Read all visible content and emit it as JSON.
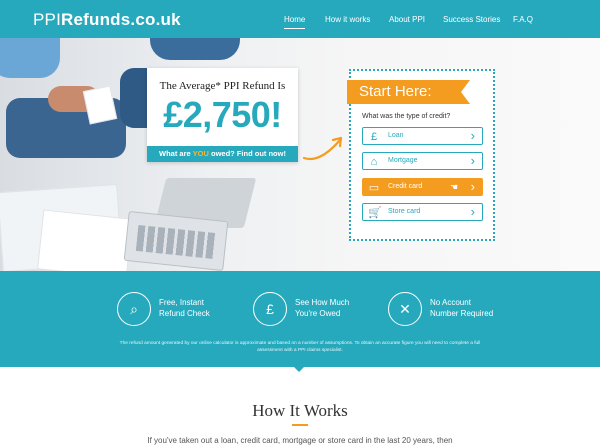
{
  "header": {
    "logo_prefix": "PPI",
    "logo_suffix": "Refunds.co.uk",
    "nav": [
      {
        "label": "Home",
        "active": true
      },
      {
        "label": "How it works"
      },
      {
        "label": "About PPI"
      },
      {
        "label": "Success Stories"
      },
      {
        "label": "F.A.Q"
      }
    ]
  },
  "hero": {
    "refund_title": "The Average* PPI Refund Is",
    "refund_amount": "£2,750!",
    "cta_prefix": "What are ",
    "cta_emph": "YOU",
    "cta_suffix": " owed? Find out now!"
  },
  "start": {
    "ribbon": "Start Here:",
    "question": "What was the type of credit?",
    "options": [
      {
        "label": "Loan",
        "icon": "pound-icon"
      },
      {
        "label": "Mortgage",
        "icon": "house-icon"
      },
      {
        "label": "Credit card",
        "icon": "credit-card-icon",
        "selected": true
      },
      {
        "label": "Store card",
        "icon": "cart-icon"
      }
    ]
  },
  "features": [
    {
      "text": "Free, Instant\nRefund Check",
      "icon": "magnifier-icon"
    },
    {
      "text": "See How Much\nYou're Owed",
      "icon": "pound-coin-icon"
    },
    {
      "text": "No Account\nNumber Required",
      "icon": "user-x-icon"
    }
  ],
  "disclaimer": "The refund amount generated by our online calculator is approximate and based on a number of assumptions. To obtain an accurate figure you will need to complete a full assessment with a PPI claims specialist.",
  "how": {
    "title": "How It Works",
    "intro": "If you've taken out a loan, credit card, mortgage or store card in the last 20 years, then"
  },
  "colors": {
    "accent": "#27a9bd",
    "highlight": "#f39c1f"
  }
}
